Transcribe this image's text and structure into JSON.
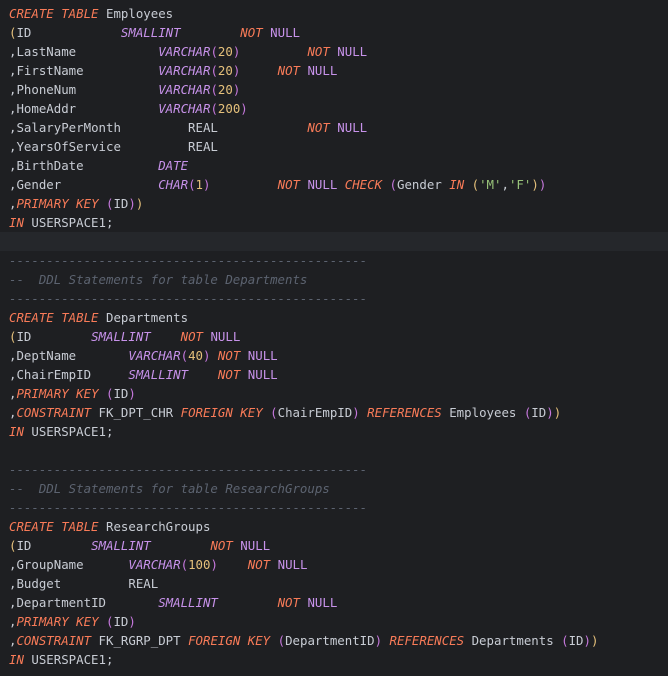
{
  "editor": {
    "colors": {
      "background": "#1e1f22",
      "current_line": "#25272b",
      "keyword": "#f97b58",
      "type": "#c792ea",
      "number": "#e5c07b",
      "string": "#98c379",
      "comment": "#5c6370",
      "identifier": "#c8ccd4"
    },
    "lines": [
      [
        [
          "CREATE TABLE",
          "kw"
        ],
        [
          " Employees",
          "id"
        ]
      ],
      [
        [
          "(",
          "p0"
        ],
        [
          "ID",
          "id"
        ],
        [
          "            ",
          "id"
        ],
        [
          "SMALLINT",
          "typ"
        ],
        [
          "        ",
          "id"
        ],
        [
          "NOT",
          "kw"
        ],
        [
          " NULL",
          "nul"
        ]
      ],
      [
        [
          ",",
          "op"
        ],
        [
          "LastName",
          "id"
        ],
        [
          "           ",
          "id"
        ],
        [
          "VARCHAR",
          "typ"
        ],
        [
          "(",
          "p1"
        ],
        [
          "20",
          "num"
        ],
        [
          ")",
          "p1"
        ],
        [
          "         ",
          "id"
        ],
        [
          "NOT",
          "kw"
        ],
        [
          " NULL",
          "nul"
        ]
      ],
      [
        [
          ",",
          "op"
        ],
        [
          "FirstName",
          "id"
        ],
        [
          "          ",
          "id"
        ],
        [
          "VARCHAR",
          "typ"
        ],
        [
          "(",
          "p1"
        ],
        [
          "20",
          "num"
        ],
        [
          ")",
          "p1"
        ],
        [
          "     ",
          "id"
        ],
        [
          "NOT",
          "kw"
        ],
        [
          " NULL",
          "nul"
        ]
      ],
      [
        [
          ",",
          "op"
        ],
        [
          "PhoneNum",
          "id"
        ],
        [
          "           ",
          "id"
        ],
        [
          "VARCHAR",
          "typ"
        ],
        [
          "(",
          "p1"
        ],
        [
          "20",
          "num"
        ],
        [
          ")",
          "p1"
        ]
      ],
      [
        [
          ",",
          "op"
        ],
        [
          "HomeAddr",
          "id"
        ],
        [
          "           ",
          "id"
        ],
        [
          "VARCHAR",
          "typ"
        ],
        [
          "(",
          "p1"
        ],
        [
          "200",
          "num"
        ],
        [
          ")",
          "p1"
        ]
      ],
      [
        [
          ",",
          "op"
        ],
        [
          "SalaryPerMonth",
          "id"
        ],
        [
          "         ",
          "id"
        ],
        [
          "REAL",
          "id"
        ],
        [
          "            ",
          "id"
        ],
        [
          "NOT",
          "kw"
        ],
        [
          " NULL",
          "nul"
        ]
      ],
      [
        [
          ",",
          "op"
        ],
        [
          "YearsOfService",
          "id"
        ],
        [
          "         ",
          "id"
        ],
        [
          "REAL",
          "id"
        ]
      ],
      [
        [
          ",",
          "op"
        ],
        [
          "BirthDate",
          "id"
        ],
        [
          "          ",
          "id"
        ],
        [
          "DATE",
          "typ"
        ]
      ],
      [
        [
          ",",
          "op"
        ],
        [
          "Gender",
          "id"
        ],
        [
          "             ",
          "id"
        ],
        [
          "CHAR",
          "typ"
        ],
        [
          "(",
          "p1"
        ],
        [
          "1",
          "num"
        ],
        [
          ")",
          "p1"
        ],
        [
          "         ",
          "id"
        ],
        [
          "NOT",
          "kw"
        ],
        [
          " NULL ",
          "nul"
        ],
        [
          "CHECK",
          "kw"
        ],
        [
          " ",
          "id"
        ],
        [
          "(",
          "p1"
        ],
        [
          "Gender ",
          "id"
        ],
        [
          "IN",
          "kw"
        ],
        [
          " ",
          "id"
        ],
        [
          "(",
          "p0"
        ],
        [
          "'M'",
          "str"
        ],
        [
          ",",
          "op"
        ],
        [
          "'F'",
          "str"
        ],
        [
          ")",
          "p0"
        ],
        [
          ")",
          "p1"
        ]
      ],
      [
        [
          ",",
          "op"
        ],
        [
          "PRIMARY KEY",
          "kw"
        ],
        [
          " ",
          "id"
        ],
        [
          "(",
          "p1"
        ],
        [
          "ID",
          "id"
        ],
        [
          ")",
          "p1"
        ],
        [
          ")",
          "p0"
        ]
      ],
      [
        [
          "IN",
          "kw"
        ],
        [
          " USERSPACE1;",
          "id"
        ]
      ],
      [],
      [
        [
          "------------------------------------------------",
          "cmt"
        ]
      ],
      [
        [
          "--  DDL Statements for table Departments",
          "cmt"
        ]
      ],
      [
        [
          "------------------------------------------------",
          "cmt"
        ]
      ],
      [
        [
          "CREATE TABLE",
          "kw"
        ],
        [
          " Departments",
          "id"
        ]
      ],
      [
        [
          "(",
          "p0"
        ],
        [
          "ID",
          "id"
        ],
        [
          "        ",
          "id"
        ],
        [
          "SMALLINT",
          "typ"
        ],
        [
          "    ",
          "id"
        ],
        [
          "NOT",
          "kw"
        ],
        [
          " NULL",
          "nul"
        ]
      ],
      [
        [
          ",",
          "op"
        ],
        [
          "DeptName",
          "id"
        ],
        [
          "       ",
          "id"
        ],
        [
          "VARCHAR",
          "typ"
        ],
        [
          "(",
          "p1"
        ],
        [
          "40",
          "num"
        ],
        [
          ")",
          "p1"
        ],
        [
          " ",
          "id"
        ],
        [
          "NOT",
          "kw"
        ],
        [
          " NULL",
          "nul"
        ]
      ],
      [
        [
          ",",
          "op"
        ],
        [
          "ChairEmpID",
          "id"
        ],
        [
          "     ",
          "id"
        ],
        [
          "SMALLINT",
          "typ"
        ],
        [
          "    ",
          "id"
        ],
        [
          "NOT",
          "kw"
        ],
        [
          " NULL",
          "nul"
        ]
      ],
      [
        [
          ",",
          "op"
        ],
        [
          "PRIMARY KEY",
          "kw"
        ],
        [
          " ",
          "id"
        ],
        [
          "(",
          "p1"
        ],
        [
          "ID",
          "id"
        ],
        [
          ")",
          "p1"
        ]
      ],
      [
        [
          ",",
          "op"
        ],
        [
          "CONSTRAINT",
          "kw"
        ],
        [
          " FK_DPT_CHR ",
          "id"
        ],
        [
          "FOREIGN KEY",
          "kw"
        ],
        [
          " ",
          "id"
        ],
        [
          "(",
          "p1"
        ],
        [
          "ChairEmpID",
          "id"
        ],
        [
          ")",
          "p1"
        ],
        [
          " ",
          "id"
        ],
        [
          "REFERENCES",
          "kw"
        ],
        [
          " Employees ",
          "id"
        ],
        [
          "(",
          "p1"
        ],
        [
          "ID",
          "id"
        ],
        [
          ")",
          "p1"
        ],
        [
          ")",
          "p0"
        ]
      ],
      [
        [
          "IN",
          "kw"
        ],
        [
          " USERSPACE1;",
          "id"
        ]
      ],
      [],
      [
        [
          "------------------------------------------------",
          "cmt"
        ]
      ],
      [
        [
          "--  DDL Statements for table ResearchGroups",
          "cmt"
        ]
      ],
      [
        [
          "------------------------------------------------",
          "cmt"
        ]
      ],
      [
        [
          "CREATE TABLE",
          "kw"
        ],
        [
          " ResearchGroups",
          "id"
        ]
      ],
      [
        [
          "(",
          "p0"
        ],
        [
          "ID",
          "id"
        ],
        [
          "        ",
          "id"
        ],
        [
          "SMALLINT",
          "typ"
        ],
        [
          "        ",
          "id"
        ],
        [
          "NOT",
          "kw"
        ],
        [
          " NULL",
          "nul"
        ]
      ],
      [
        [
          ",",
          "op"
        ],
        [
          "GroupName",
          "id"
        ],
        [
          "      ",
          "id"
        ],
        [
          "VARCHAR",
          "typ"
        ],
        [
          "(",
          "p1"
        ],
        [
          "100",
          "num"
        ],
        [
          ")",
          "p1"
        ],
        [
          "    ",
          "id"
        ],
        [
          "NOT",
          "kw"
        ],
        [
          " NULL",
          "nul"
        ]
      ],
      [
        [
          ",",
          "op"
        ],
        [
          "Budget",
          "id"
        ],
        [
          "         ",
          "id"
        ],
        [
          "REAL",
          "id"
        ]
      ],
      [
        [
          ",",
          "op"
        ],
        [
          "DepartmentID",
          "id"
        ],
        [
          "       ",
          "id"
        ],
        [
          "SMALLINT",
          "typ"
        ],
        [
          "        ",
          "id"
        ],
        [
          "NOT",
          "kw"
        ],
        [
          " NULL",
          "nul"
        ]
      ],
      [
        [
          ",",
          "op"
        ],
        [
          "PRIMARY KEY",
          "kw"
        ],
        [
          " ",
          "id"
        ],
        [
          "(",
          "p1"
        ],
        [
          "ID",
          "id"
        ],
        [
          ")",
          "p1"
        ]
      ],
      [
        [
          ",",
          "op"
        ],
        [
          "CONSTRAINT",
          "kw"
        ],
        [
          " FK_RGRP_DPT ",
          "id"
        ],
        [
          "FOREIGN KEY",
          "kw"
        ],
        [
          " ",
          "id"
        ],
        [
          "(",
          "p1"
        ],
        [
          "DepartmentID",
          "id"
        ],
        [
          ")",
          "p1"
        ],
        [
          " ",
          "id"
        ],
        [
          "REFERENCES",
          "kw"
        ],
        [
          " Departments ",
          "id"
        ],
        [
          "(",
          "p1"
        ],
        [
          "ID",
          "id"
        ],
        [
          ")",
          "p1"
        ],
        [
          ")",
          "p0"
        ]
      ],
      [
        [
          "IN",
          "kw"
        ],
        [
          " USERSPACE1;",
          "id"
        ]
      ]
    ]
  }
}
